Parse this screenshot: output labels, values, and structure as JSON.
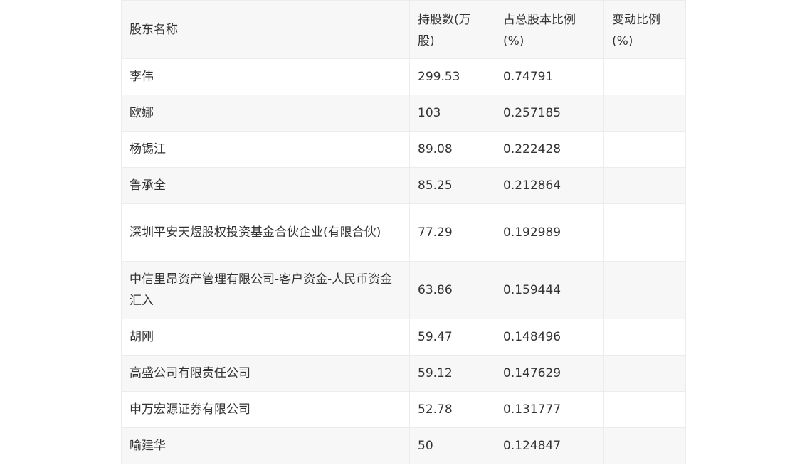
{
  "table": {
    "headers": [
      "股东名称",
      "持股数(万股)",
      "占总股本比例(%)",
      "变动比例(%)"
    ],
    "rows": [
      [
        "李伟",
        "299.53",
        "0.74791",
        ""
      ],
      [
        "欧娜",
        "103",
        "0.257185",
        ""
      ],
      [
        "杨锡江",
        "89.08",
        "0.222428",
        ""
      ],
      [
        "鲁承全",
        "85.25",
        "0.212864",
        ""
      ],
      [
        "深圳平安天煜股权投资基金合伙企业(有限合伙)",
        "77.29",
        "0.192989",
        ""
      ],
      [
        "中信里昂资产管理有限公司-客户资金-人民币资金汇入",
        "63.86",
        "0.159444",
        ""
      ],
      [
        "胡刚",
        "59.47",
        "0.148496",
        ""
      ],
      [
        "高盛公司有限责任公司",
        "59.12",
        "0.147629",
        ""
      ],
      [
        "申万宏源证券有限公司",
        "52.78",
        "0.131777",
        ""
      ],
      [
        "喻建华",
        "50",
        "0.124847",
        ""
      ]
    ]
  }
}
